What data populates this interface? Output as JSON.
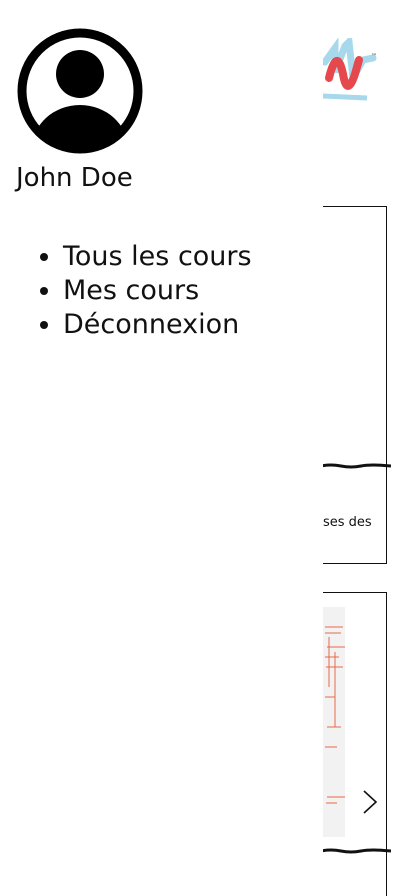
{
  "user": {
    "name": "John Doe",
    "avatar_icon": "user-circle-icon"
  },
  "menu": {
    "items": [
      {
        "label": "Tous les cours"
      },
      {
        "label": "Mes cours"
      },
      {
        "label": "Déconnexion"
      }
    ]
  },
  "background": {
    "card1_text": "ses des",
    "next_icon": "chevron-right-icon",
    "logo_icon": "brand-logo-icon"
  },
  "colors": {
    "logo_red": "#e5484d",
    "logo_blue": "#a7d8ec",
    "text": "#111111"
  }
}
